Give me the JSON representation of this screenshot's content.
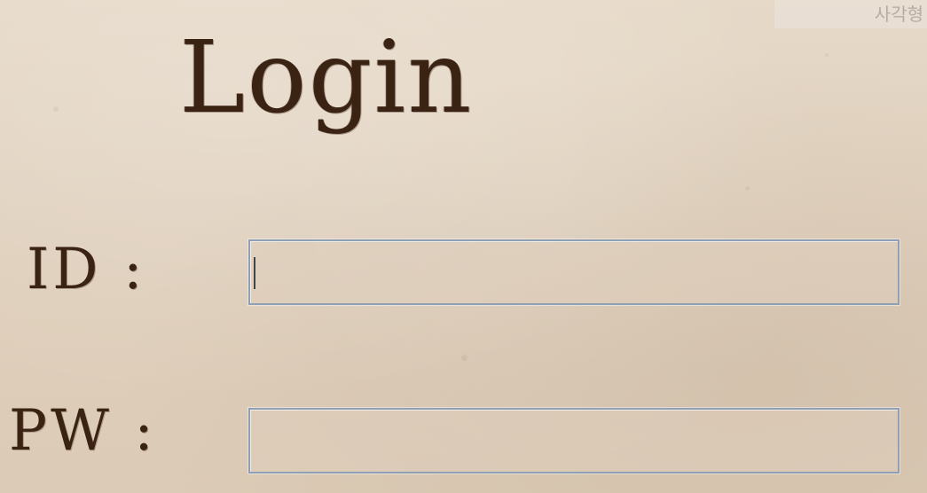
{
  "window": {
    "corner_overlay_text": "  사각형"
  },
  "title": "Login",
  "form": {
    "id_label": "ID :",
    "id_value": "",
    "pw_label": "PW :",
    "pw_value": ""
  },
  "colors": {
    "background": "#e3d5c3",
    "ink": "#3b2314",
    "field_border": "#8fa0b4"
  }
}
